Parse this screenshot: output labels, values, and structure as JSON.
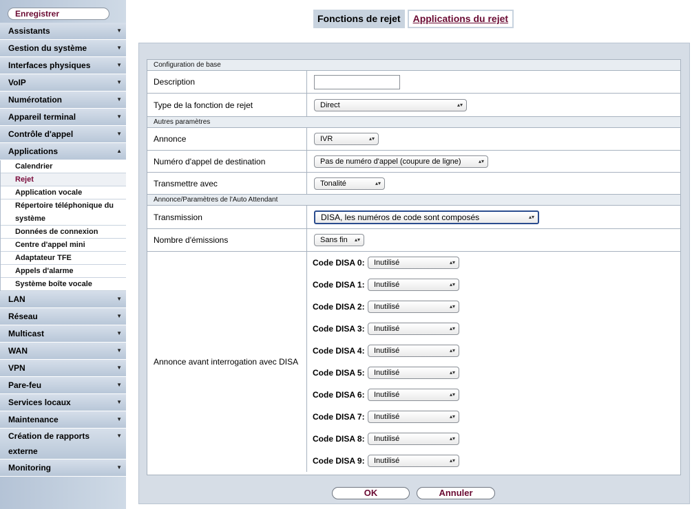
{
  "sidebar": {
    "register_label": "Enregistrer",
    "items_before": [
      "Assistants",
      "Gestion du système",
      "Interfaces physiques",
      "VoIP",
      "Numérotation",
      "Appareil terminal",
      "Contrôle d'appel"
    ],
    "expanded": {
      "label": "Applications",
      "subitems": [
        "Calendrier",
        "Rejet",
        "Application vocale",
        "Répertoire téléphonique du système",
        "Données de connexion",
        "Centre d'appel mini",
        "Adaptateur TFE",
        "Appels d'alarme",
        "Système boîte vocale"
      ],
      "active": "Rejet"
    },
    "items_after": [
      "LAN",
      "Réseau",
      "Multicast",
      "WAN",
      "VPN",
      "Pare-feu",
      "Services locaux",
      "Maintenance",
      "Création de rapports externe",
      "Monitoring"
    ]
  },
  "tabs": {
    "active": "Fonctions de rejet",
    "other": "Applications du rejet"
  },
  "sections": {
    "basic": "Configuration de base",
    "other": "Autres paramètres",
    "auto_attendant": "Annonce/Paramètres de l'Auto Attendant"
  },
  "fields": {
    "description_label": "Description",
    "description_value": "",
    "type_label": "Type de la fonction de rejet",
    "type_value": "Direct",
    "annonce_label": "Annonce",
    "annonce_value": "IVR",
    "dest_label": "Numéro d'appel de destination",
    "dest_value": "Pas de numéro d'appel (coupure de ligne)",
    "transmettre_label": "Transmettre avec",
    "transmettre_value": "Tonalité",
    "transmission_label": "Transmission",
    "transmission_value": "DISA, les numéros de code sont composés",
    "emissions_label": "Nombre d'émissions",
    "emissions_value": "Sans fin",
    "disa_group_label": "Annonce avant interrogation avec DISA"
  },
  "disa_codes": [
    {
      "label": "Code DISA 0:",
      "value": "Inutilisé"
    },
    {
      "label": "Code DISA 1:",
      "value": "Inutilisé"
    },
    {
      "label": "Code DISA 2:",
      "value": "Inutilisé"
    },
    {
      "label": "Code DISA 3:",
      "value": "Inutilisé"
    },
    {
      "label": "Code DISA 4:",
      "value": "Inutilisé"
    },
    {
      "label": "Code DISA 5:",
      "value": "Inutilisé"
    },
    {
      "label": "Code DISA 6:",
      "value": "Inutilisé"
    },
    {
      "label": "Code DISA 7:",
      "value": "Inutilisé"
    },
    {
      "label": "Code DISA 8:",
      "value": "Inutilisé"
    },
    {
      "label": "Code DISA 9:",
      "value": "Inutilisé"
    }
  ],
  "buttons": {
    "ok": "OK",
    "cancel": "Annuler"
  },
  "colors": {
    "accent": "#6a0a32",
    "menu_bg": "#c4d0de",
    "panel_bg": "#d6dde6"
  }
}
